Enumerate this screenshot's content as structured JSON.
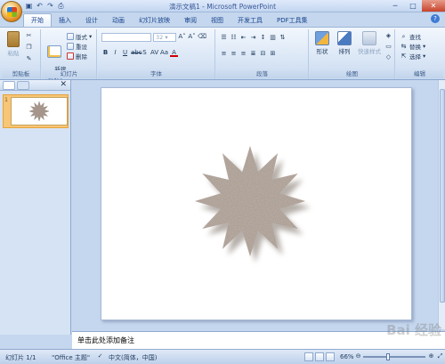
{
  "window": {
    "title": "演示文稿1 - Microsoft PowerPoint",
    "minimize_glyph": "─",
    "maximize_glyph": "□",
    "close_glyph": "✕"
  },
  "qat": [
    "save-icon",
    "undo-icon",
    "redo-icon",
    "print-icon"
  ],
  "tabs": [
    {
      "label": "开始",
      "active": true
    },
    {
      "label": "插入"
    },
    {
      "label": "设计"
    },
    {
      "label": "动画"
    },
    {
      "label": "幻灯片放映"
    },
    {
      "label": "审阅"
    },
    {
      "label": "视图"
    },
    {
      "label": "开发工具"
    },
    {
      "label": "PDF工具集"
    }
  ],
  "ribbon": {
    "clipboard": {
      "label": "剪贴板",
      "paste": "粘贴"
    },
    "slides": {
      "label": "幻灯片",
      "new_slide": "新建\n幻灯片",
      "layout": "版式",
      "reset": "重设",
      "delete": "删除"
    },
    "font": {
      "label": "字体",
      "font_size": "32"
    },
    "paragraph": {
      "label": "段落"
    },
    "drawing": {
      "label": "绘图",
      "shapes": "形状",
      "arrange": "排列",
      "quick_styles": "快速样式"
    },
    "editing": {
      "label": "编辑",
      "find": "查找",
      "replace": "替换",
      "select": "选择"
    }
  },
  "thumbnail": {
    "number": "1"
  },
  "notes": {
    "placeholder": "单击此处添加备注"
  },
  "status": {
    "slide_count": "幻灯片 1/1",
    "theme": "\"Office 主题\"",
    "language": "中文(简体，中国)",
    "zoom": "66%"
  },
  "shape": {
    "fill": "#a5958a",
    "shadow": "#7a6d64"
  },
  "watermark": "Bai 经验"
}
